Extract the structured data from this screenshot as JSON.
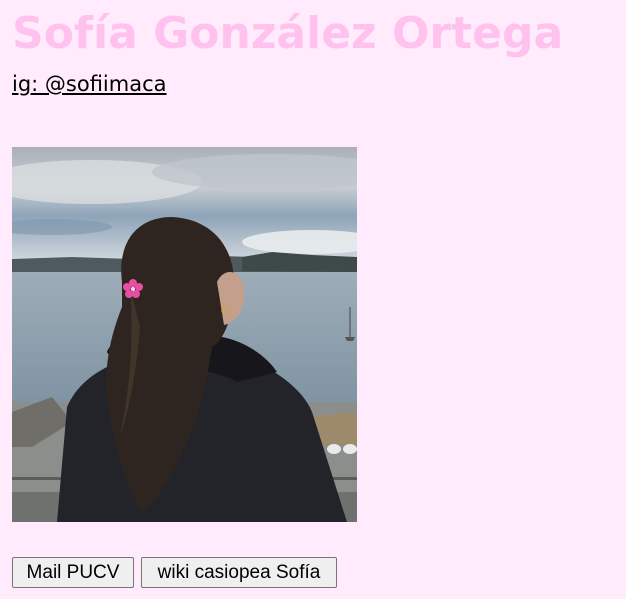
{
  "page": {
    "title": "Sofía González Ortega",
    "instagram_link": "ig: @sofiimaca",
    "background_color": "#ffebfb",
    "title_color": "#ffc2ee"
  },
  "photo": {
    "subject": "woman-with-long-dark-hair-and-pink-flower-clip-looking-at-bay",
    "colors": {
      "sky": "#b9c3cc",
      "water": "#95a6b3",
      "hair": "#2e2520",
      "jacket": "#23232a",
      "flower": "#e84fa4"
    }
  },
  "buttons": {
    "mail_label": "Mail PUCV",
    "wiki_label": "wiki casiopea Sofía"
  }
}
